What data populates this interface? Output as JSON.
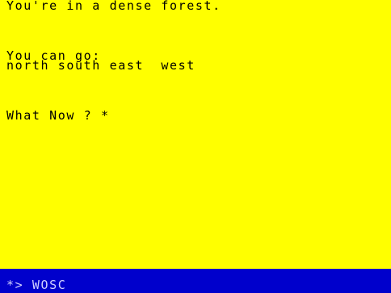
{
  "game": {
    "location_text": "You're in a dense forest.",
    "exits_heading": "You can go:",
    "exits_list": "north south east  west",
    "prompt": "What Now ? *",
    "input_line": "*> WOSC"
  },
  "colors": {
    "background": "#ffff00",
    "text": "#000000",
    "input_bar": "#0000cc",
    "input_text": "#cfcfff"
  }
}
